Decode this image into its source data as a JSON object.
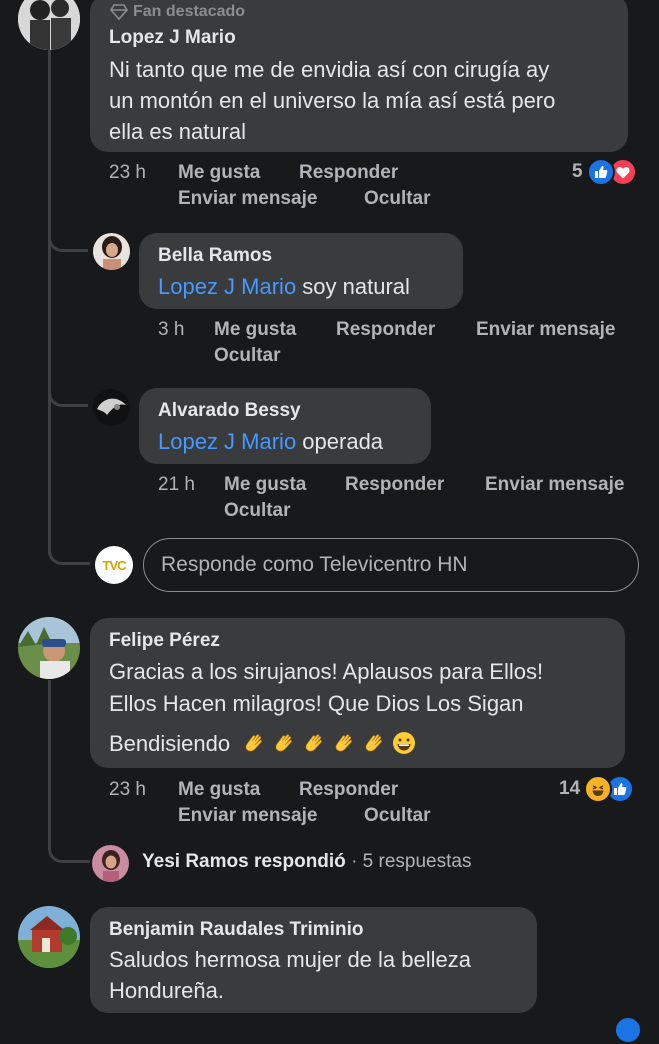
{
  "comments": [
    {
      "badge": "Fan destacado",
      "author": "Lopez J Mario",
      "lines": [
        "Ni tanto que me de envidia así con cirugía ay",
        "un montón en el universo la mía así está pero",
        "ella es natural"
      ],
      "time": "23 h",
      "like": "Me gusta",
      "reply": "Responder",
      "message": "Enviar mensaje",
      "hide": "Ocultar",
      "reactions_count": "5",
      "reactions": [
        "like-icon",
        "love-icon"
      ]
    },
    {
      "author": "Bella Ramos",
      "mention": "Lopez J Mario",
      "text": " soy natural",
      "time": "3 h",
      "like": "Me gusta",
      "reply": "Responder",
      "message": "Enviar mensaje",
      "hide": "Ocultar"
    },
    {
      "author": "Alvarado Bessy",
      "mention": "Lopez J Mario",
      "text": " operada",
      "time": "21 h",
      "like": "Me gusta",
      "reply": "Responder",
      "message": "Enviar mensaje",
      "hide": "Ocultar"
    },
    {
      "author": "Felipe Pérez",
      "lines": [
        "Gracias a los sirujanos!  Aplausos para Ellos!",
        "Ellos Hacen milagros!  Que Dios Los Sigan",
        "Bendisiendo"
      ],
      "emojis": [
        "clapping-hands",
        "clapping-hands",
        "clapping-hands",
        "clapping-hands",
        "clapping-hands",
        "grinning-face"
      ],
      "time": "23 h",
      "like": "Me gusta",
      "reply": "Responder",
      "message": "Enviar mensaje",
      "hide": "Ocultar",
      "reactions_count": "14",
      "reactions": [
        "haha-icon",
        "like-icon"
      ]
    },
    {
      "author": "Benjamin Raudales Triminio",
      "lines": [
        "Saludos hermosa mujer de la belleza",
        "Hondureña."
      ]
    }
  ],
  "reply_box": {
    "placeholder": "Responde como Televicentro HN",
    "avatar_text": "TVC"
  },
  "replies_summary": {
    "author": "Yesi Ramos",
    "action": " respondió",
    "count": " · 5 respuestas"
  },
  "colors": {
    "background": "#18191a",
    "bubble": "#3a3b3c",
    "mention": "#4599ff",
    "like": "#1b74e4",
    "love": "#f33e58"
  }
}
